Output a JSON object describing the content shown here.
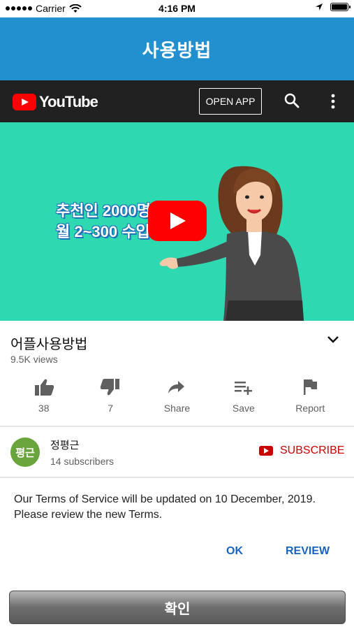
{
  "status_bar": {
    "carrier": "Carrier",
    "time": "4:16 PM"
  },
  "app_header": {
    "title": "사용방법"
  },
  "yt_header": {
    "logo_text": "YouTube",
    "open_app": "OPEN APP"
  },
  "video": {
    "overlay_line1": "추천인 2000명",
    "overlay_line2": "월 2~300 수입"
  },
  "video_info": {
    "title": "어플사용방법",
    "views": "9.5K views"
  },
  "actions": [
    {
      "icon": "thumbs-up-icon",
      "label": "38"
    },
    {
      "icon": "thumbs-down-icon",
      "label": "7"
    },
    {
      "icon": "share-icon",
      "label": "Share"
    },
    {
      "icon": "save-playlist-icon",
      "label": "Save"
    },
    {
      "icon": "flag-icon",
      "label": "Report"
    }
  ],
  "channel": {
    "avatar_text": "평근",
    "name": "정평근",
    "subscribers": "14 subscribers",
    "subscribe_label": "SUBSCRIBE"
  },
  "terms": {
    "message": "Our Terms of Service will be updated on 10 December, 2019. Please review the new Terms.",
    "ok": "OK",
    "review": "REVIEW"
  },
  "confirm_button": "확인",
  "colors": {
    "header_blue": "#2290cf",
    "video_bg": "#2ed8b0",
    "youtube_red": "#ff0000",
    "link_blue": "#1565c0"
  }
}
